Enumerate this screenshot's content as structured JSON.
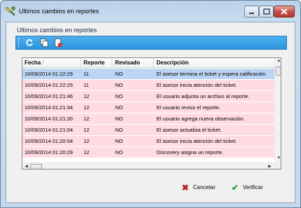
{
  "window": {
    "title": "Ultimos cambios en reportes"
  },
  "group": {
    "title": "Ultimos cambios en reportes"
  },
  "toolbar": {
    "buttons": [
      "refresh-icon",
      "copy-icon",
      "export-icon"
    ]
  },
  "grid": {
    "columns": [
      "Fecha",
      "Reporte",
      "Revisado",
      "Descripción"
    ],
    "sort_indicator": "/",
    "rows": [
      {
        "fecha": "10/09/2014 01:22:29",
        "reporte": "11",
        "revisado": "NO",
        "descripcion": "El asesor termina el ticket y espera calificación.",
        "selected": true
      },
      {
        "fecha": "10/09/2014 01:22:25",
        "reporte": "11",
        "revisado": "NO",
        "descripcion": "El asesor inicia atención del ticket."
      },
      {
        "fecha": "10/09/2014 01:21:46",
        "reporte": "12",
        "revisado": "NO",
        "descripcion": "El usuario adjunta un archivo al reporte."
      },
      {
        "fecha": "10/09/2014 01:21:34",
        "reporte": "12",
        "revisado": "NO",
        "descripcion": "El usuario reviso el reporte."
      },
      {
        "fecha": "10/09/2014 01:21:30",
        "reporte": "12",
        "revisado": "NO",
        "descripcion": "El usuario agrega nueva observación."
      },
      {
        "fecha": "10/09/2014 01:21:04",
        "reporte": "12",
        "revisado": "NO",
        "descripcion": "El asesor actualiza el ticket."
      },
      {
        "fecha": "10/09/2014 01:20:54",
        "reporte": "12",
        "revisado": "NO",
        "descripcion": "El asesor inicia atención del ticket."
      },
      {
        "fecha": "10/09/2014 01:20:29",
        "reporte": "12",
        "revisado": "NO",
        "descripcion": "Discovery asigna un reporte."
      }
    ]
  },
  "actions": {
    "cancel_label": "Cancelar",
    "cancel_icon": "x-icon",
    "verify_label": "Verificar",
    "verify_icon": "checkmark-icon"
  },
  "colors": {
    "row_bg": "#ffdbe2",
    "selected_bg": "#bcd5f5",
    "toolbar": "#2b93de",
    "cancel_icon": "#b22222",
    "verify_icon": "#2e9e2e"
  }
}
